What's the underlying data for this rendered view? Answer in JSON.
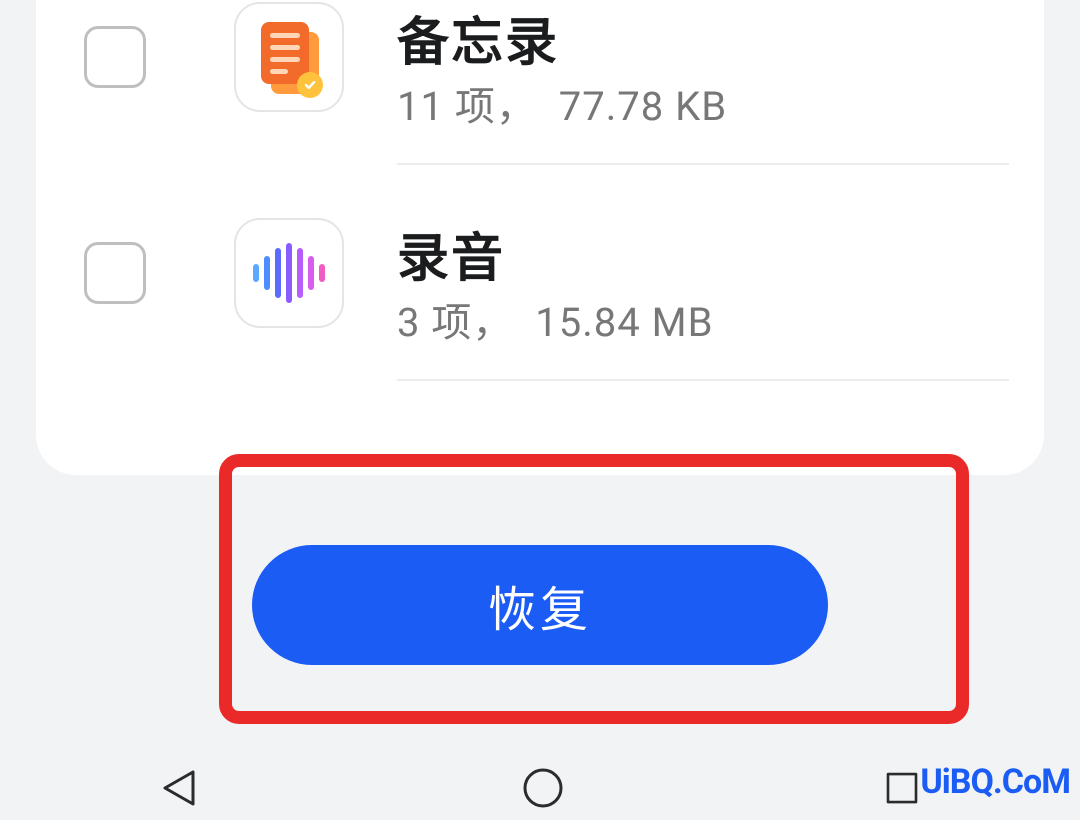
{
  "list": {
    "items": [
      {
        "title": "备忘录",
        "count_label": "11 项，",
        "size_label": "77.78 KB"
      },
      {
        "title": "录音",
        "count_label": "3 项，",
        "size_label": "15.84 MB"
      }
    ]
  },
  "action": {
    "restore_label": "恢复"
  },
  "watermark": "UiBQ.CoM"
}
